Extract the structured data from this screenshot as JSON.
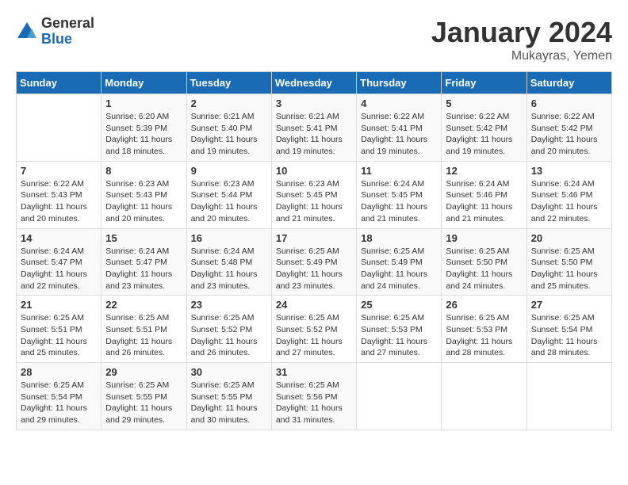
{
  "logo": {
    "general": "General",
    "blue": "Blue"
  },
  "header": {
    "month": "January 2024",
    "location": "Mukayras, Yemen"
  },
  "weekdays": [
    "Sunday",
    "Monday",
    "Tuesday",
    "Wednesday",
    "Thursday",
    "Friday",
    "Saturday"
  ],
  "weeks": [
    [
      {
        "day": "",
        "info": ""
      },
      {
        "day": "1",
        "info": "Sunrise: 6:20 AM\nSunset: 5:39 PM\nDaylight: 11 hours and 18 minutes."
      },
      {
        "day": "2",
        "info": "Sunrise: 6:21 AM\nSunset: 5:40 PM\nDaylight: 11 hours and 19 minutes."
      },
      {
        "day": "3",
        "info": "Sunrise: 6:21 AM\nSunset: 5:41 PM\nDaylight: 11 hours and 19 minutes."
      },
      {
        "day": "4",
        "info": "Sunrise: 6:22 AM\nSunset: 5:41 PM\nDaylight: 11 hours and 19 minutes."
      },
      {
        "day": "5",
        "info": "Sunrise: 6:22 AM\nSunset: 5:42 PM\nDaylight: 11 hours and 19 minutes."
      },
      {
        "day": "6",
        "info": "Sunrise: 6:22 AM\nSunset: 5:42 PM\nDaylight: 11 hours and 20 minutes."
      }
    ],
    [
      {
        "day": "7",
        "info": "Sunrise: 6:22 AM\nSunset: 5:43 PM\nDaylight: 11 hours and 20 minutes."
      },
      {
        "day": "8",
        "info": "Sunrise: 6:23 AM\nSunset: 5:43 PM\nDaylight: 11 hours and 20 minutes."
      },
      {
        "day": "9",
        "info": "Sunrise: 6:23 AM\nSunset: 5:44 PM\nDaylight: 11 hours and 20 minutes."
      },
      {
        "day": "10",
        "info": "Sunrise: 6:23 AM\nSunset: 5:45 PM\nDaylight: 11 hours and 21 minutes."
      },
      {
        "day": "11",
        "info": "Sunrise: 6:24 AM\nSunset: 5:45 PM\nDaylight: 11 hours and 21 minutes."
      },
      {
        "day": "12",
        "info": "Sunrise: 6:24 AM\nSunset: 5:46 PM\nDaylight: 11 hours and 21 minutes."
      },
      {
        "day": "13",
        "info": "Sunrise: 6:24 AM\nSunset: 5:46 PM\nDaylight: 11 hours and 22 minutes."
      }
    ],
    [
      {
        "day": "14",
        "info": "Sunrise: 6:24 AM\nSunset: 5:47 PM\nDaylight: 11 hours and 22 minutes."
      },
      {
        "day": "15",
        "info": "Sunrise: 6:24 AM\nSunset: 5:47 PM\nDaylight: 11 hours and 23 minutes."
      },
      {
        "day": "16",
        "info": "Sunrise: 6:24 AM\nSunset: 5:48 PM\nDaylight: 11 hours and 23 minutes."
      },
      {
        "day": "17",
        "info": "Sunrise: 6:25 AM\nSunset: 5:49 PM\nDaylight: 11 hours and 23 minutes."
      },
      {
        "day": "18",
        "info": "Sunrise: 6:25 AM\nSunset: 5:49 PM\nDaylight: 11 hours and 24 minutes."
      },
      {
        "day": "19",
        "info": "Sunrise: 6:25 AM\nSunset: 5:50 PM\nDaylight: 11 hours and 24 minutes."
      },
      {
        "day": "20",
        "info": "Sunrise: 6:25 AM\nSunset: 5:50 PM\nDaylight: 11 hours and 25 minutes."
      }
    ],
    [
      {
        "day": "21",
        "info": "Sunrise: 6:25 AM\nSunset: 5:51 PM\nDaylight: 11 hours and 25 minutes."
      },
      {
        "day": "22",
        "info": "Sunrise: 6:25 AM\nSunset: 5:51 PM\nDaylight: 11 hours and 26 minutes."
      },
      {
        "day": "23",
        "info": "Sunrise: 6:25 AM\nSunset: 5:52 PM\nDaylight: 11 hours and 26 minutes."
      },
      {
        "day": "24",
        "info": "Sunrise: 6:25 AM\nSunset: 5:52 PM\nDaylight: 11 hours and 27 minutes."
      },
      {
        "day": "25",
        "info": "Sunrise: 6:25 AM\nSunset: 5:53 PM\nDaylight: 11 hours and 27 minutes."
      },
      {
        "day": "26",
        "info": "Sunrise: 6:25 AM\nSunset: 5:53 PM\nDaylight: 11 hours and 28 minutes."
      },
      {
        "day": "27",
        "info": "Sunrise: 6:25 AM\nSunset: 5:54 PM\nDaylight: 11 hours and 28 minutes."
      }
    ],
    [
      {
        "day": "28",
        "info": "Sunrise: 6:25 AM\nSunset: 5:54 PM\nDaylight: 11 hours and 29 minutes."
      },
      {
        "day": "29",
        "info": "Sunrise: 6:25 AM\nSunset: 5:55 PM\nDaylight: 11 hours and 29 minutes."
      },
      {
        "day": "30",
        "info": "Sunrise: 6:25 AM\nSunset: 5:55 PM\nDaylight: 11 hours and 30 minutes."
      },
      {
        "day": "31",
        "info": "Sunrise: 6:25 AM\nSunset: 5:56 PM\nDaylight: 11 hours and 31 minutes."
      },
      {
        "day": "",
        "info": ""
      },
      {
        "day": "",
        "info": ""
      },
      {
        "day": "",
        "info": ""
      }
    ]
  ]
}
